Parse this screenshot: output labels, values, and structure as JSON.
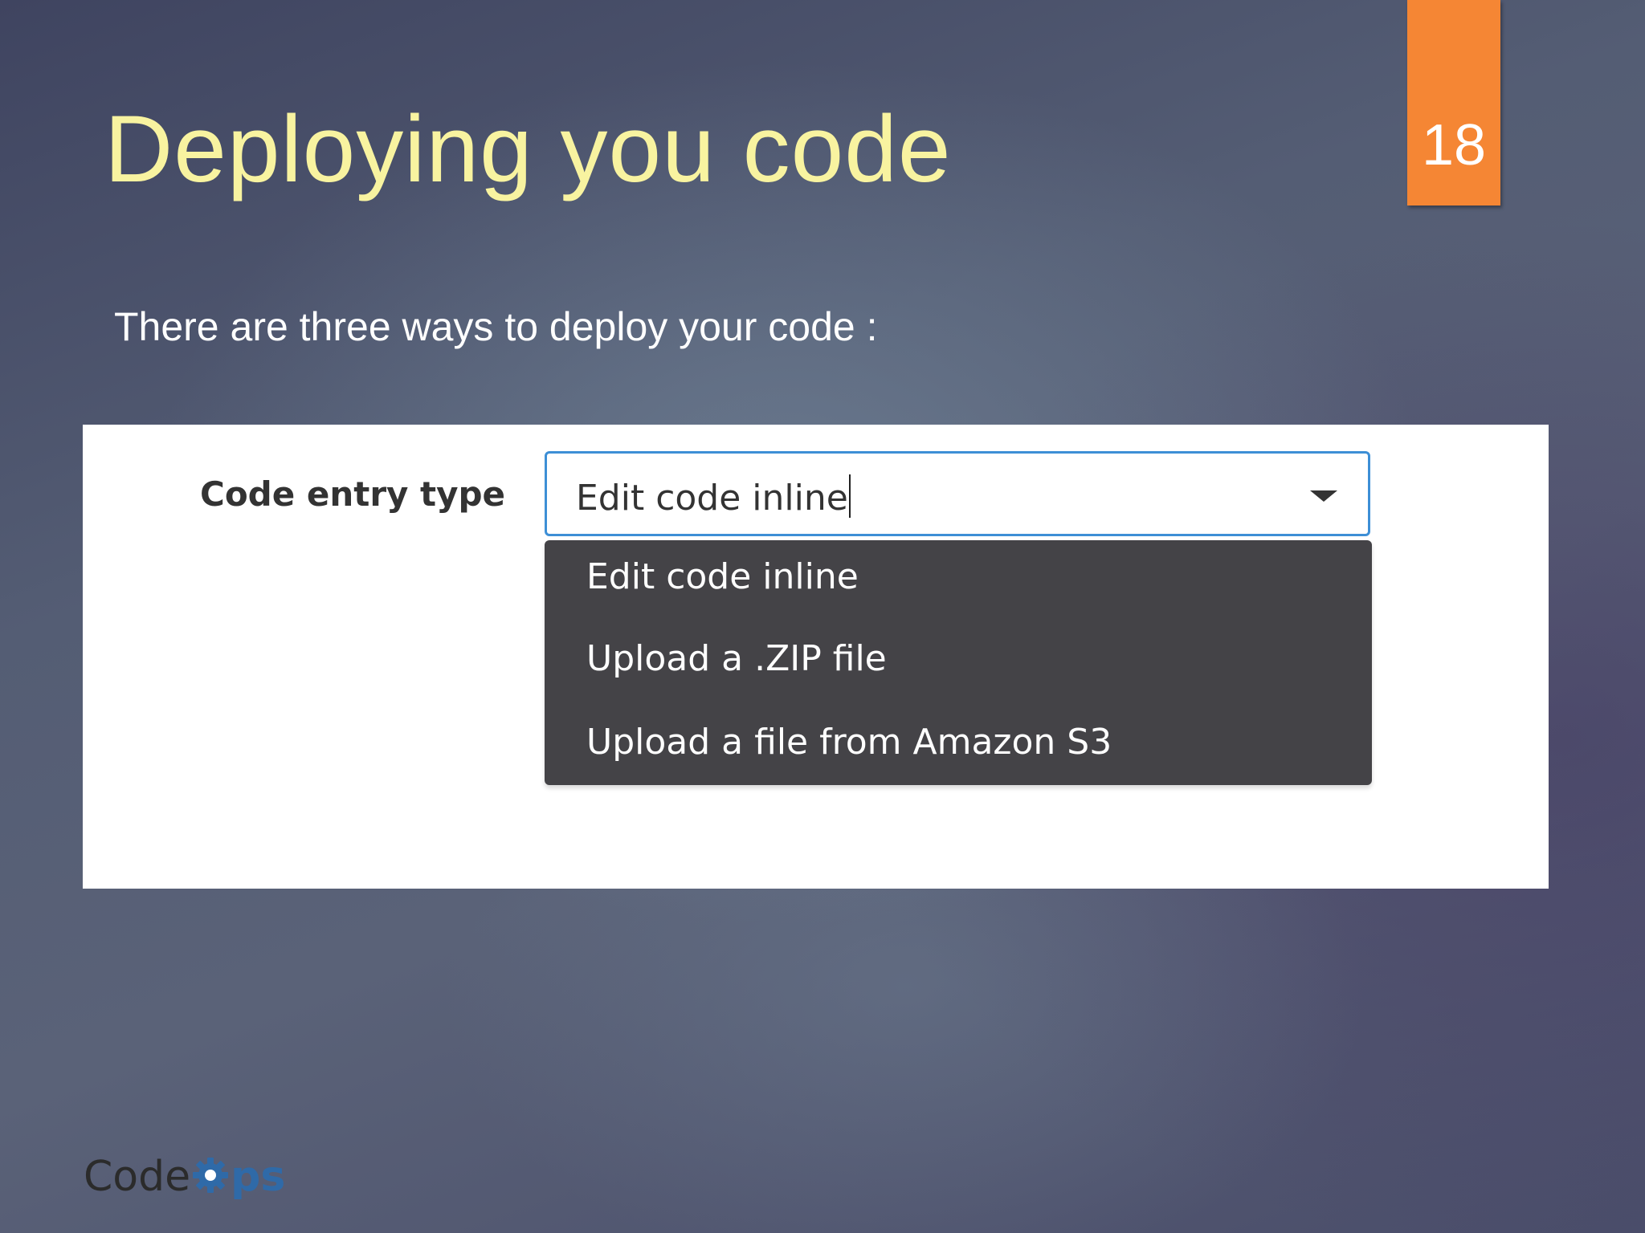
{
  "slide": {
    "title": "Deploying you code",
    "page_number": "18",
    "intro": "There are three ways to deploy your code :"
  },
  "form": {
    "label": "Code entry type",
    "selected_value": "Edit code inline",
    "options": [
      "Edit code inline",
      "Upload a .ZIP file",
      "Upload a file from Amazon S3"
    ]
  },
  "logo": {
    "code": "Code",
    "gear_icon": "gear-icon",
    "suffix": "ps"
  },
  "colors": {
    "title": "#f8f3a0",
    "page_tab": "#f58634",
    "select_border": "#3d8fd6",
    "menu_bg": "#444347",
    "logo_accent": "#2f6aa8"
  }
}
